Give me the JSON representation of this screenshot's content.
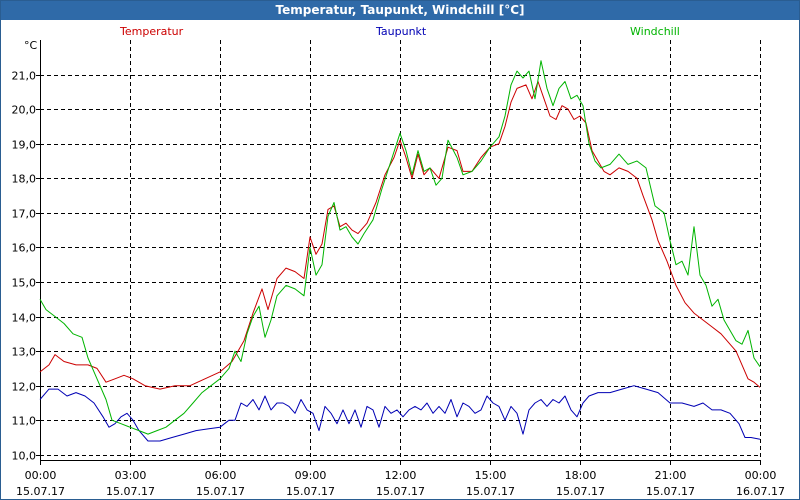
{
  "window": {
    "title": "Temperatur, Taupunkt, Windchill [°C]"
  },
  "colors": {
    "temperatur": "#cc0000",
    "taupunkt": "#0000b4",
    "windchill": "#00b400",
    "grid": "#000000",
    "titlebar": "#2f6aa8"
  },
  "chart_data": {
    "type": "line",
    "title": "Temperatur, Taupunkt, Windchill [°C]",
    "ylabel": "°C",
    "ylim": [
      9.85,
      22.0
    ],
    "xlim_hours": [
      0,
      24
    ],
    "grid": true,
    "legend_position": "top",
    "y_ticks": [
      "10,0",
      "11,0",
      "12,0",
      "13,0",
      "14,0",
      "15,0",
      "16,0",
      "17,0",
      "18,0",
      "19,0",
      "20,0",
      "21,0"
    ],
    "x_ticks": [
      {
        "time": "00:00",
        "date": "15.07.17"
      },
      {
        "time": "03:00",
        "date": "15.07.17"
      },
      {
        "time": "06:00",
        "date": "15.07.17"
      },
      {
        "time": "09:00",
        "date": "15.07.17"
      },
      {
        "time": "12:00",
        "date": "15.07.17"
      },
      {
        "time": "15:00",
        "date": "15.07.17"
      },
      {
        "time": "18:00",
        "date": "15.07.17"
      },
      {
        "time": "21:00",
        "date": "15.07.17"
      },
      {
        "time": "00:00",
        "date": "16.07.17"
      }
    ],
    "series": [
      {
        "name": "Temperatur",
        "color": "#cc0000",
        "points": [
          [
            0,
            12.4
          ],
          [
            0.3,
            12.6
          ],
          [
            0.5,
            12.9
          ],
          [
            0.8,
            12.7
          ],
          [
            1.2,
            12.6
          ],
          [
            1.6,
            12.6
          ],
          [
            1.9,
            12.5
          ],
          [
            2.2,
            12.1
          ],
          [
            2.5,
            12.2
          ],
          [
            2.8,
            12.3
          ],
          [
            3.1,
            12.2
          ],
          [
            3.5,
            12.0
          ],
          [
            4.0,
            11.9
          ],
          [
            4.5,
            12.0
          ],
          [
            5.0,
            12.0
          ],
          [
            5.5,
            12.2
          ],
          [
            6.0,
            12.4
          ],
          [
            6.4,
            12.7
          ],
          [
            6.8,
            13.3
          ],
          [
            7.1,
            14.1
          ],
          [
            7.4,
            14.8
          ],
          [
            7.6,
            14.2
          ],
          [
            7.9,
            15.1
          ],
          [
            8.2,
            15.4
          ],
          [
            8.5,
            15.3
          ],
          [
            8.8,
            15.1
          ],
          [
            9.0,
            16.3
          ],
          [
            9.2,
            15.8
          ],
          [
            9.4,
            16.1
          ],
          [
            9.6,
            17.1
          ],
          [
            9.8,
            17.2
          ],
          [
            10.0,
            16.6
          ],
          [
            10.2,
            16.7
          ],
          [
            10.4,
            16.5
          ],
          [
            10.6,
            16.4
          ],
          [
            10.9,
            16.7
          ],
          [
            11.2,
            17.3
          ],
          [
            11.5,
            18.1
          ],
          [
            11.8,
            18.6
          ],
          [
            12.0,
            19.1
          ],
          [
            12.2,
            18.6
          ],
          [
            12.4,
            18.0
          ],
          [
            12.6,
            18.7
          ],
          [
            12.8,
            18.1
          ],
          [
            13.0,
            18.3
          ],
          [
            13.3,
            18.0
          ],
          [
            13.6,
            18.9
          ],
          [
            13.9,
            18.8
          ],
          [
            14.1,
            18.2
          ],
          [
            14.4,
            18.2
          ],
          [
            14.7,
            18.6
          ],
          [
            15.0,
            18.9
          ],
          [
            15.3,
            19.0
          ],
          [
            15.5,
            19.5
          ],
          [
            15.7,
            20.2
          ],
          [
            15.9,
            20.6
          ],
          [
            16.2,
            20.7
          ],
          [
            16.4,
            20.3
          ],
          [
            16.6,
            20.8
          ],
          [
            16.8,
            20.3
          ],
          [
            17.0,
            19.8
          ],
          [
            17.2,
            19.7
          ],
          [
            17.4,
            20.1
          ],
          [
            17.6,
            20.0
          ],
          [
            17.8,
            19.7
          ],
          [
            18.0,
            19.8
          ],
          [
            18.2,
            19.6
          ],
          [
            18.4,
            18.8
          ],
          [
            18.6,
            18.5
          ],
          [
            18.8,
            18.2
          ],
          [
            19.0,
            18.1
          ],
          [
            19.3,
            18.3
          ],
          [
            19.6,
            18.2
          ],
          [
            19.9,
            18.0
          ],
          [
            20.1,
            17.5
          ],
          [
            20.4,
            16.8
          ],
          [
            20.6,
            16.2
          ],
          [
            20.9,
            15.6
          ],
          [
            21.2,
            14.9
          ],
          [
            21.5,
            14.4
          ],
          [
            21.8,
            14.1
          ],
          [
            22.1,
            13.9
          ],
          [
            22.4,
            13.7
          ],
          [
            22.7,
            13.5
          ],
          [
            23.0,
            13.2
          ],
          [
            23.2,
            13.0
          ],
          [
            23.4,
            12.6
          ],
          [
            23.6,
            12.2
          ],
          [
            23.8,
            12.1
          ],
          [
            24.0,
            11.95
          ]
        ]
      },
      {
        "name": "Taupunkt",
        "color": "#0000b4",
        "points": [
          [
            0,
            11.6
          ],
          [
            0.3,
            11.9
          ],
          [
            0.6,
            11.9
          ],
          [
            0.9,
            11.7
          ],
          [
            1.2,
            11.8
          ],
          [
            1.5,
            11.7
          ],
          [
            1.8,
            11.5
          ],
          [
            2.1,
            11.1
          ],
          [
            2.3,
            10.8
          ],
          [
            2.5,
            10.9
          ],
          [
            2.7,
            11.1
          ],
          [
            2.9,
            11.2
          ],
          [
            3.1,
            11.0
          ],
          [
            3.3,
            10.7
          ],
          [
            3.6,
            10.4
          ],
          [
            4.0,
            10.4
          ],
          [
            4.4,
            10.5
          ],
          [
            4.8,
            10.6
          ],
          [
            5.2,
            10.7
          ],
          [
            5.6,
            10.75
          ],
          [
            6.0,
            10.8
          ],
          [
            6.3,
            11.0
          ],
          [
            6.5,
            11.0
          ],
          [
            6.7,
            11.5
          ],
          [
            6.9,
            11.4
          ],
          [
            7.1,
            11.6
          ],
          [
            7.3,
            11.3
          ],
          [
            7.5,
            11.7
          ],
          [
            7.7,
            11.3
          ],
          [
            7.9,
            11.5
          ],
          [
            8.1,
            11.5
          ],
          [
            8.3,
            11.4
          ],
          [
            8.5,
            11.2
          ],
          [
            8.7,
            11.6
          ],
          [
            8.9,
            11.3
          ],
          [
            9.1,
            11.2
          ],
          [
            9.3,
            10.7
          ],
          [
            9.5,
            11.4
          ],
          [
            9.7,
            11.2
          ],
          [
            9.9,
            10.9
          ],
          [
            10.1,
            11.3
          ],
          [
            10.3,
            10.9
          ],
          [
            10.5,
            11.3
          ],
          [
            10.7,
            10.8
          ],
          [
            10.9,
            11.4
          ],
          [
            11.1,
            11.3
          ],
          [
            11.3,
            10.8
          ],
          [
            11.5,
            11.4
          ],
          [
            11.7,
            11.2
          ],
          [
            11.9,
            11.3
          ],
          [
            12.1,
            11.1
          ],
          [
            12.3,
            11.3
          ],
          [
            12.5,
            11.4
          ],
          [
            12.7,
            11.3
          ],
          [
            12.9,
            11.5
          ],
          [
            13.1,
            11.2
          ],
          [
            13.3,
            11.4
          ],
          [
            13.5,
            11.2
          ],
          [
            13.7,
            11.6
          ],
          [
            13.9,
            11.1
          ],
          [
            14.1,
            11.5
          ],
          [
            14.3,
            11.4
          ],
          [
            14.5,
            11.2
          ],
          [
            14.7,
            11.3
          ],
          [
            14.9,
            11.7
          ],
          [
            15.1,
            11.5
          ],
          [
            15.3,
            11.4
          ],
          [
            15.5,
            11.0
          ],
          [
            15.7,
            11.4
          ],
          [
            15.9,
            11.2
          ],
          [
            16.1,
            10.6
          ],
          [
            16.3,
            11.3
          ],
          [
            16.5,
            11.5
          ],
          [
            16.7,
            11.6
          ],
          [
            16.9,
            11.4
          ],
          [
            17.1,
            11.6
          ],
          [
            17.3,
            11.5
          ],
          [
            17.5,
            11.7
          ],
          [
            17.7,
            11.3
          ],
          [
            17.9,
            11.1
          ],
          [
            18.1,
            11.5
          ],
          [
            18.3,
            11.7
          ],
          [
            18.6,
            11.8
          ],
          [
            19.0,
            11.8
          ],
          [
            19.4,
            11.9
          ],
          [
            19.8,
            12.0
          ],
          [
            20.2,
            11.9
          ],
          [
            20.6,
            11.8
          ],
          [
            21.0,
            11.5
          ],
          [
            21.4,
            11.5
          ],
          [
            21.8,
            11.4
          ],
          [
            22.1,
            11.5
          ],
          [
            22.4,
            11.3
          ],
          [
            22.7,
            11.3
          ],
          [
            23.0,
            11.2
          ],
          [
            23.3,
            10.9
          ],
          [
            23.5,
            10.5
          ],
          [
            23.7,
            10.5
          ],
          [
            24.0,
            10.45
          ]
        ]
      },
      {
        "name": "Windchill",
        "color": "#00b400",
        "points": [
          [
            0,
            14.5
          ],
          [
            0.2,
            14.2
          ],
          [
            0.5,
            14.0
          ],
          [
            0.8,
            13.8
          ],
          [
            1.1,
            13.5
          ],
          [
            1.4,
            13.4
          ],
          [
            1.6,
            12.8
          ],
          [
            1.9,
            12.2
          ],
          [
            2.2,
            11.6
          ],
          [
            2.4,
            11.0
          ],
          [
            2.7,
            10.9
          ],
          [
            3.0,
            10.8
          ],
          [
            3.3,
            10.7
          ],
          [
            3.6,
            10.6
          ],
          [
            3.9,
            10.7
          ],
          [
            4.2,
            10.8
          ],
          [
            4.5,
            11.0
          ],
          [
            4.8,
            11.2
          ],
          [
            5.1,
            11.5
          ],
          [
            5.4,
            11.8
          ],
          [
            5.7,
            12.0
          ],
          [
            6.0,
            12.2
          ],
          [
            6.3,
            12.5
          ],
          [
            6.5,
            13.0
          ],
          [
            6.7,
            12.7
          ],
          [
            6.9,
            13.5
          ],
          [
            7.1,
            14.0
          ],
          [
            7.3,
            14.3
          ],
          [
            7.5,
            13.4
          ],
          [
            7.7,
            13.9
          ],
          [
            7.9,
            14.6
          ],
          [
            8.2,
            14.9
          ],
          [
            8.5,
            14.8
          ],
          [
            8.8,
            14.6
          ],
          [
            9.0,
            16.0
          ],
          [
            9.2,
            15.2
          ],
          [
            9.4,
            15.5
          ],
          [
            9.6,
            16.9
          ],
          [
            9.8,
            17.3
          ],
          [
            10.0,
            16.5
          ],
          [
            10.2,
            16.6
          ],
          [
            10.4,
            16.3
          ],
          [
            10.6,
            16.1
          ],
          [
            10.8,
            16.4
          ],
          [
            11.1,
            16.8
          ],
          [
            11.4,
            17.7
          ],
          [
            11.7,
            18.5
          ],
          [
            12.0,
            19.3
          ],
          [
            12.2,
            18.8
          ],
          [
            12.4,
            18.1
          ],
          [
            12.6,
            18.8
          ],
          [
            12.8,
            18.2
          ],
          [
            13.0,
            18.3
          ],
          [
            13.2,
            17.8
          ],
          [
            13.4,
            18.0
          ],
          [
            13.6,
            19.1
          ],
          [
            13.9,
            18.6
          ],
          [
            14.1,
            18.1
          ],
          [
            14.4,
            18.2
          ],
          [
            14.7,
            18.5
          ],
          [
            15.0,
            18.9
          ],
          [
            15.3,
            19.2
          ],
          [
            15.5,
            19.8
          ],
          [
            15.7,
            20.7
          ],
          [
            15.9,
            21.1
          ],
          [
            16.1,
            20.9
          ],
          [
            16.3,
            21.1
          ],
          [
            16.5,
            20.3
          ],
          [
            16.7,
            21.4
          ],
          [
            16.9,
            20.6
          ],
          [
            17.1,
            20.1
          ],
          [
            17.3,
            20.6
          ],
          [
            17.5,
            20.8
          ],
          [
            17.7,
            20.3
          ],
          [
            17.9,
            20.4
          ],
          [
            18.1,
            20.1
          ],
          [
            18.3,
            19.0
          ],
          [
            18.5,
            18.5
          ],
          [
            18.7,
            18.3
          ],
          [
            19.0,
            18.4
          ],
          [
            19.3,
            18.7
          ],
          [
            19.6,
            18.4
          ],
          [
            19.9,
            18.5
          ],
          [
            20.2,
            18.3
          ],
          [
            20.5,
            17.2
          ],
          [
            20.8,
            17.0
          ],
          [
            21.0,
            16.2
          ],
          [
            21.2,
            15.5
          ],
          [
            21.4,
            15.6
          ],
          [
            21.6,
            15.2
          ],
          [
            21.8,
            16.6
          ],
          [
            22.0,
            15.2
          ],
          [
            22.2,
            14.9
          ],
          [
            22.4,
            14.3
          ],
          [
            22.6,
            14.5
          ],
          [
            22.8,
            13.9
          ],
          [
            23.0,
            13.6
          ],
          [
            23.2,
            13.3
          ],
          [
            23.4,
            13.2
          ],
          [
            23.6,
            13.6
          ],
          [
            23.8,
            12.8
          ],
          [
            24.0,
            12.55
          ]
        ]
      }
    ]
  }
}
